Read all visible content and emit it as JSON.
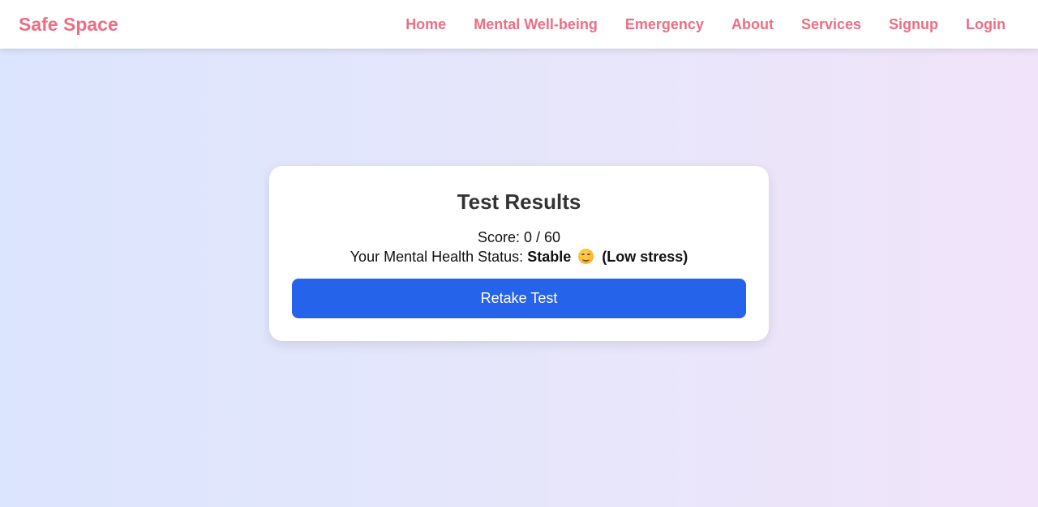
{
  "navbar": {
    "brand": "Safe Space",
    "links": [
      "Home",
      "Mental Well-being",
      "Emergency",
      "About",
      "Services",
      "Signup",
      "Login"
    ]
  },
  "results": {
    "title": "Test Results",
    "score_line": "Score: 0 / 60",
    "status_prefix": "Your Mental Health Status:",
    "status_value": "Stable",
    "status_emoji": "smiling-face-icon",
    "status_note": "(Low stress)",
    "retake_label": "Retake Test"
  },
  "colors": {
    "brand": "#ee6d82",
    "button": "#2563eb",
    "title": "#333333"
  }
}
